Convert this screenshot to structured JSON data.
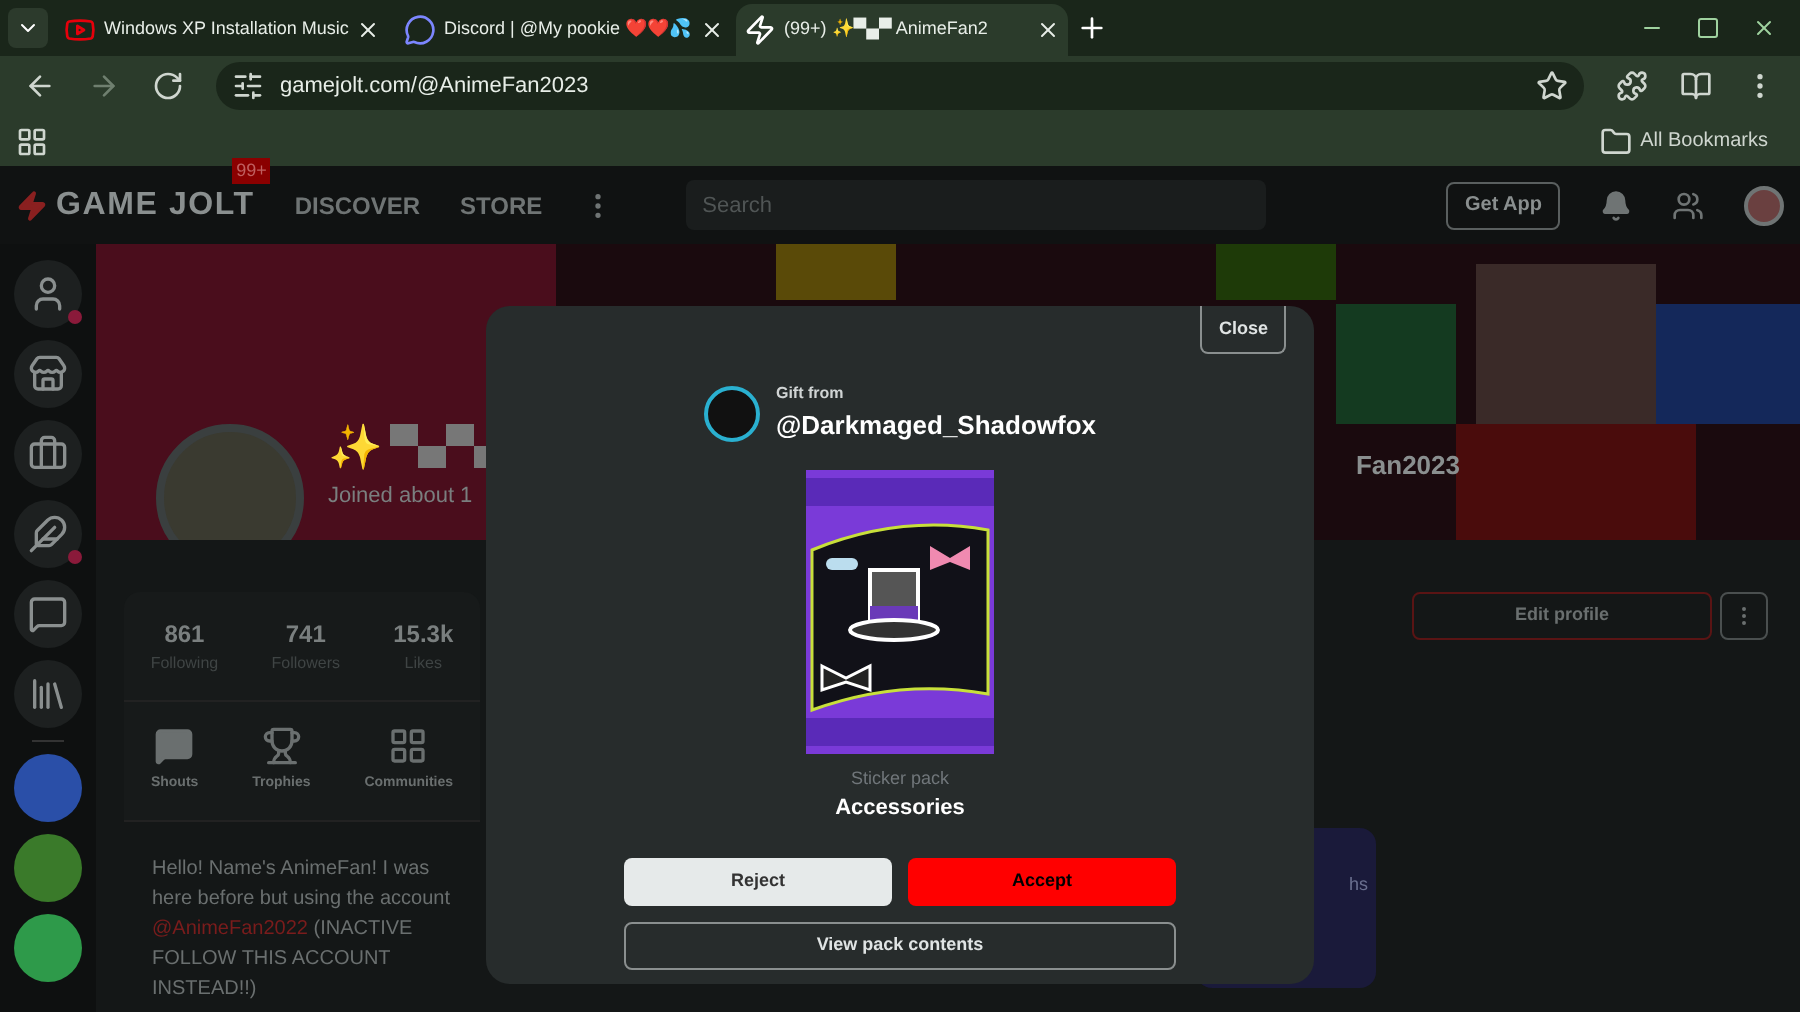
{
  "browser": {
    "tabs": [
      {
        "title": "Windows XP Installation Music",
        "selected": false,
        "kind": "video"
      },
      {
        "title": "Discord | @My pookie ❤️❤️💦",
        "selected": false,
        "kind": "chat"
      },
      {
        "title": "(99+) ✨▀▄▀ AnimeFan2",
        "selected": true,
        "kind": "game"
      }
    ],
    "address": "gamejolt.com/@AnimeFan2023",
    "bookmarks_label": "All Bookmarks"
  },
  "nav": {
    "logo": "GAME JOLT",
    "logo_badge": "99+",
    "links": [
      "DISCOVER",
      "STORE"
    ],
    "search": {
      "placeholder": "Search"
    },
    "get_app": "Get App"
  },
  "sidebar": {
    "items": [
      {
        "kind": "person",
        "unread": true
      },
      {
        "kind": "store",
        "unread": false
      },
      {
        "kind": "bag",
        "unread": false
      },
      {
        "kind": "quill",
        "unread": true
      },
      {
        "kind": "chat",
        "unread": false
      },
      {
        "kind": "library",
        "unread": false
      }
    ],
    "communities": [
      {
        "color": "#2a4fa8"
      },
      {
        "color": "#3a7a2a"
      },
      {
        "color": "#2e9a4a"
      }
    ]
  },
  "profile": {
    "name_sparkle": "✨",
    "joined": "Joined about 1",
    "name_end": "Fan2023",
    "stats": [
      {
        "value": "861",
        "label": "Following"
      },
      {
        "value": "741",
        "label": "Followers"
      },
      {
        "value": "15.3k",
        "label": "Likes"
      }
    ],
    "sections": [
      {
        "label": "Shouts",
        "kind": "shouts"
      },
      {
        "label": "Trophies",
        "kind": "trophies"
      },
      {
        "label": "Communities",
        "kind": "communities"
      }
    ],
    "bio": {
      "before": "Hello! Name's AnimeFan! I was here before but using the account",
      "link": "@AnimeFan2022",
      "after": "(INACTIVE FOLLOW THIS ACCOUNT INSTEAD!!)"
    },
    "edit_profile": "Edit profile",
    "card_fragment": "hs"
  },
  "gift": {
    "close": "Close",
    "label": "Gift from",
    "sender": "@Darkmaged_Shadowfox",
    "pack_type": "Sticker pack",
    "pack_name": "Accessories",
    "reject": "Reject",
    "accept": "Accept",
    "view": "View pack contents"
  }
}
